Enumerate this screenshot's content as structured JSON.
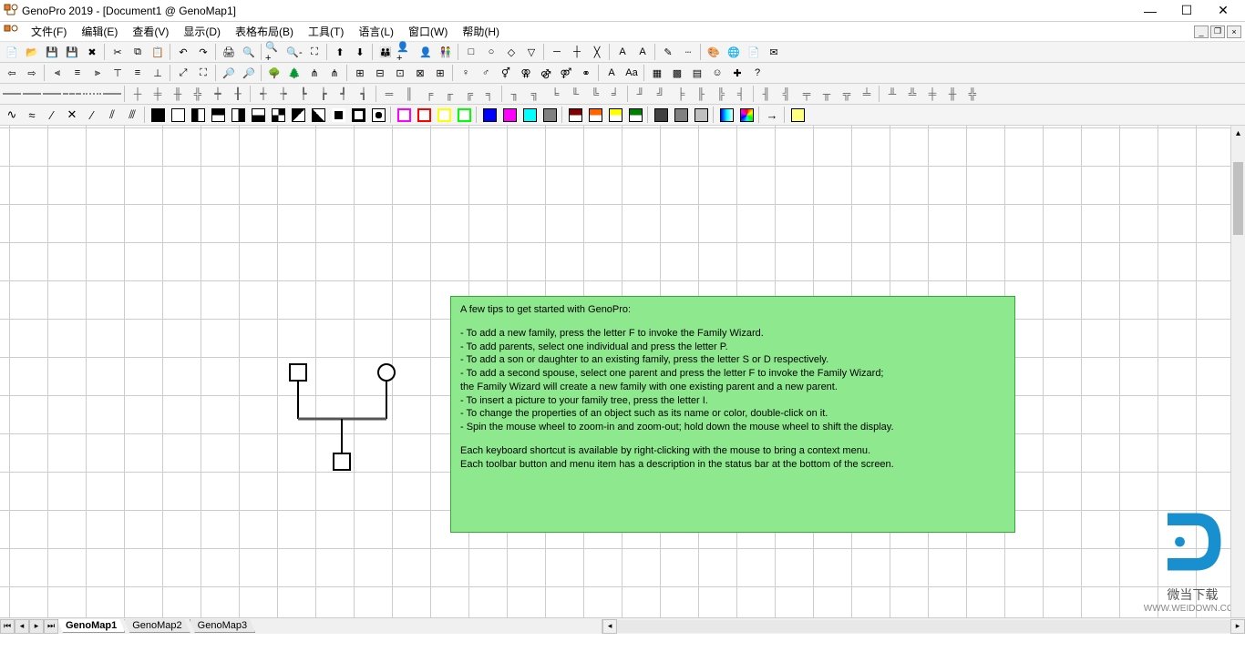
{
  "title": "GenoPro 2019 - [Document1 @ GenoMap1]",
  "menus": [
    "文件(F)",
    "编辑(E)",
    "查看(V)",
    "显示(D)",
    "表格布局(B)",
    "工具(T)",
    "语言(L)",
    "窗口(W)",
    "帮助(H)"
  ],
  "tabs": {
    "active": "GenoMap1",
    "items": [
      "GenoMap1",
      "GenoMap2",
      "GenoMap3"
    ]
  },
  "tips": {
    "heading": "A few tips to get started with GenoPro:",
    "bullets": [
      "- To add a new family, press the letter F to invoke the Family Wizard.",
      "- To add parents, select one individual and press the letter P.",
      "- To add a son or daughter to an existing family, press the letter S or D respectively.",
      "- To add a second spouse, select one parent and press the letter F to invoke the Family Wizard;",
      "  the Family Wizard will create a new family with one existing parent and a new parent.",
      "- To insert a picture to your family tree, press the letter I.",
      "- To change the properties of an object such as its name or color, double-click on it.",
      "- Spin the mouse wheel to zoom-in and zoom-out; hold down the mouse wheel to shift the display."
    ],
    "footer1": "Each keyboard shortcut is available by right-clicking with the mouse to bring a context menu.",
    "footer2": "Each toolbar button and menu item has a description in the status bar at the bottom of the screen."
  },
  "watermark": {
    "line1": "微当下载",
    "line2": "WWW.WEIDOWN.COM"
  },
  "icons": {
    "row1": [
      "new-doc",
      "open",
      "save",
      "save-all",
      "close",
      "|",
      "cut",
      "copy",
      "paste",
      "|",
      "undo",
      "redo",
      "|",
      "print",
      "find",
      "|",
      "zoom-in",
      "zoom-out",
      "zoom-fit",
      "|",
      "tree-up",
      "tree-down",
      "|",
      "family",
      "person-add",
      "person",
      "couple",
      "|",
      "male",
      "female",
      "unknown",
      "child",
      "|",
      "link1",
      "link2",
      "link3",
      "|",
      "text",
      "text-a",
      "|",
      "wand",
      "dash",
      "|",
      "color",
      "globe",
      "doc",
      "mail"
    ],
    "row2": [
      "back",
      "forward",
      "|",
      "align-l",
      "align-c",
      "align-r",
      "align-t",
      "align-m",
      "align-b",
      "|",
      "resize",
      "fit",
      "|",
      "zoom1",
      "zoom2",
      "|",
      "tree1",
      "tree2",
      "tree3",
      "tree4",
      "|",
      "g1",
      "g2",
      "g3",
      "g4",
      "g5",
      "|",
      "p1",
      "p2",
      "p3",
      "p4",
      "p5",
      "p6",
      "p7",
      "|",
      "text-a",
      "text-aa",
      "|",
      "grid1",
      "grid2",
      "grid3",
      "face",
      "new",
      "help"
    ]
  }
}
